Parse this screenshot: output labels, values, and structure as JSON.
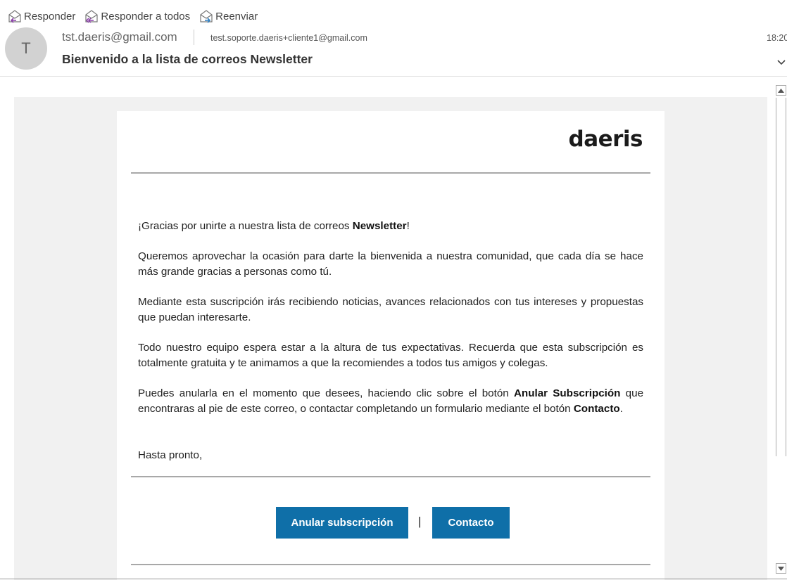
{
  "toolbar": {
    "reply": "Responder",
    "reply_all": "Responder a todos",
    "forward": "Reenviar"
  },
  "message": {
    "avatar_initial": "T",
    "from": "tst.daeris@gmail.com",
    "to": "test.soporte.daeris+cliente1@gmail.com",
    "time": "18:20",
    "subject": "Bienvenido a la lista de correos Newsletter"
  },
  "email": {
    "logo": "daeris",
    "p1_pre": "¡Gracias por unirte a nuestra lista de correos ",
    "p1_bold": "Newsletter",
    "p1_post": "!",
    "p2": "Queremos aprovechar la ocasión para darte la bienvenida a nuestra comunidad, que cada día se hace más grande gracias a personas como tú.",
    "p3": "Mediante esta suscripción irás recibiendo noticias, avances relacionados con tus intereses y propuestas que puedan interesarte.",
    "p4": "Todo nuestro equipo espera estar a la altura de tus expectativas. Recuerda que esta subscripción es totalmente gratuita y te animamos a que la recomiendes a todos tus amigos y colegas.",
    "p5_a": "Puedes anularla en el momento que desees, haciendo clic sobre el botón ",
    "p5_b": "Anular Subscripción",
    "p5_c": " que encontraras al pie de este correo, o contactar completando un formulario mediante el botón ",
    "p5_d": "Contacto",
    "p5_e": ".",
    "closing": "Hasta pronto,",
    "btn_unsubscribe": "Anular subscripción",
    "separator": "|",
    "btn_contact": "Contacto"
  },
  "colors": {
    "button": "#0f6fa8",
    "pane_bg": "#f1f1f1"
  }
}
